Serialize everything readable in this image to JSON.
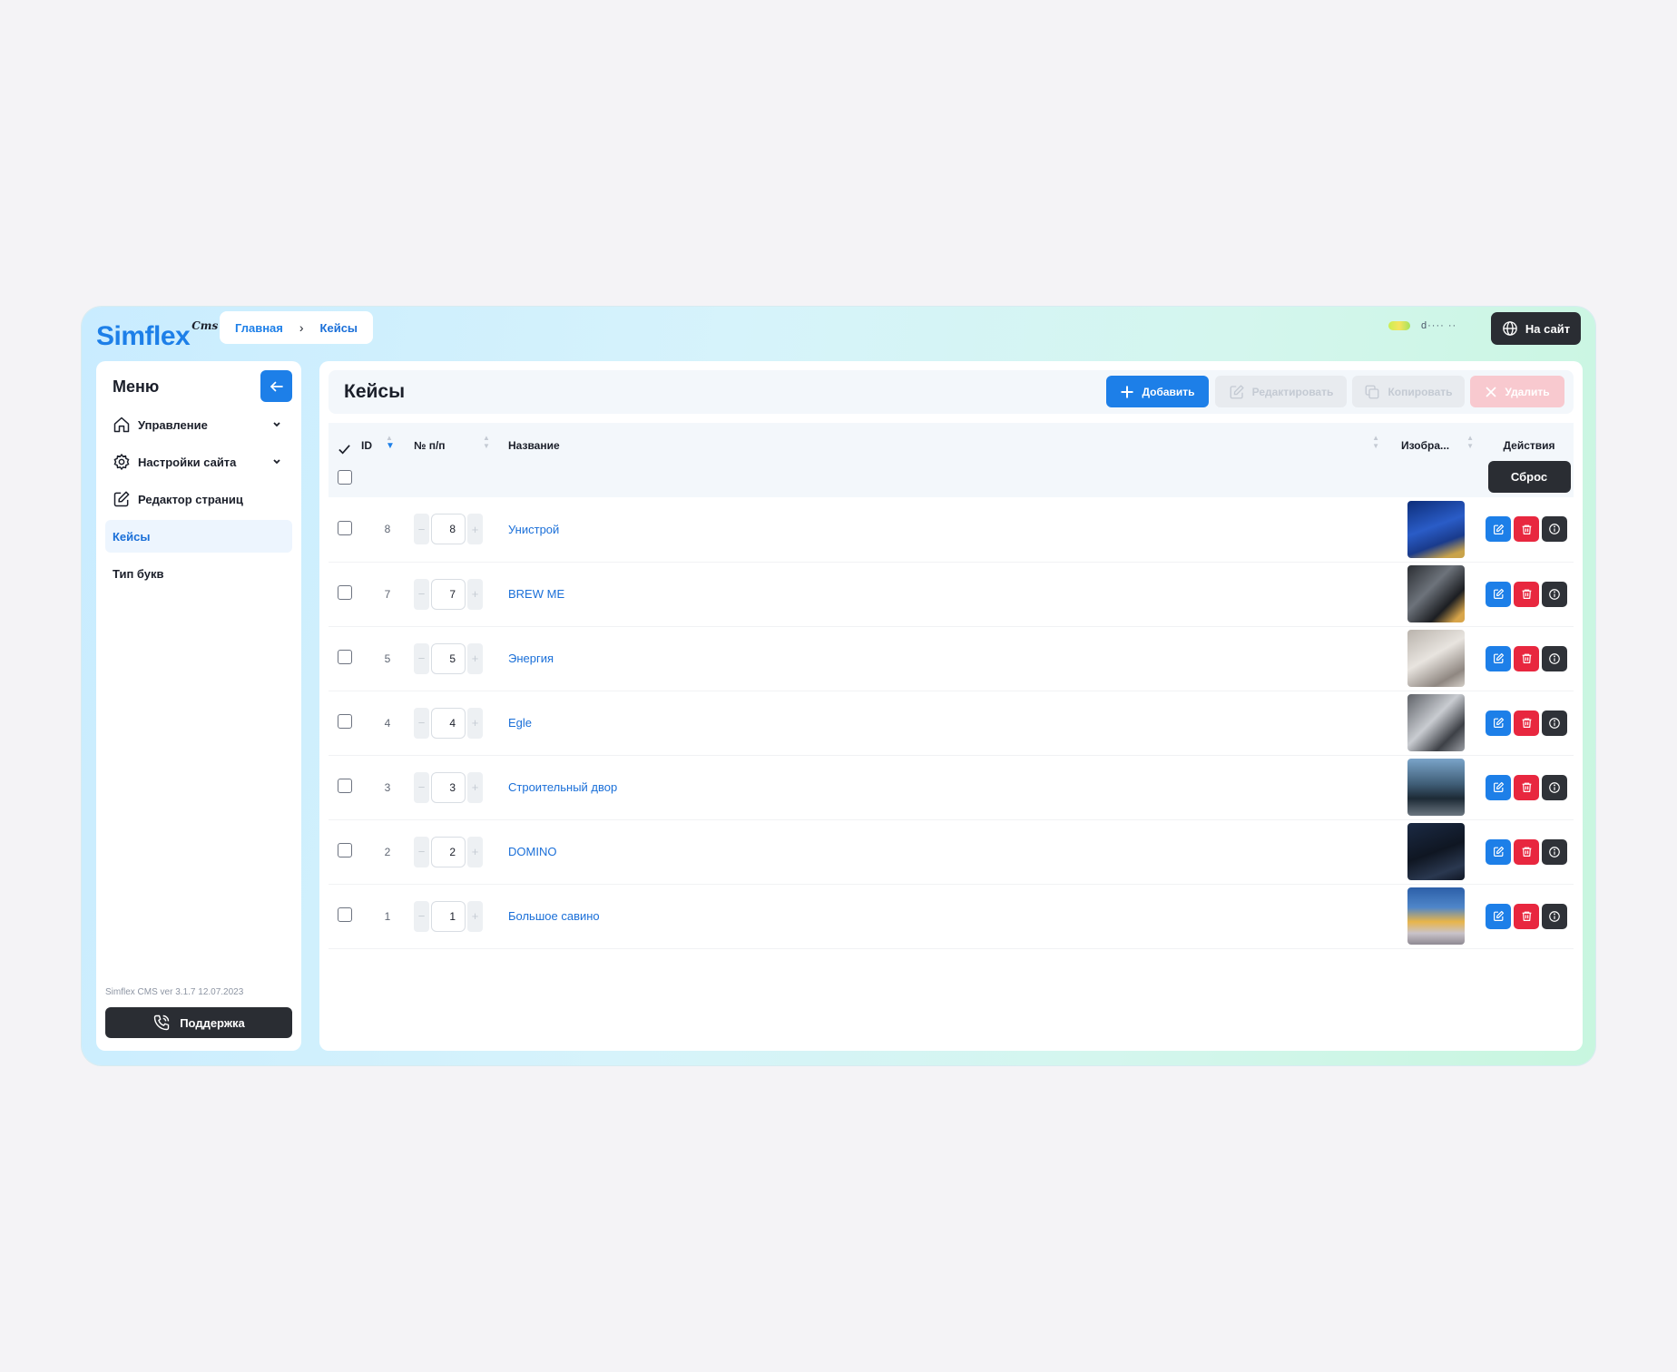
{
  "header": {
    "logo_text": "Simflex",
    "logo_suffix": "Cms",
    "breadcrumb": [
      "Главная",
      "Кейсы"
    ],
    "user_name": "d···· ··",
    "site_button": "На сайт"
  },
  "sidebar": {
    "title": "Меню",
    "items": [
      {
        "label": "Управление",
        "icon": "home-icon",
        "expandable": true
      },
      {
        "label": "Настройки сайта",
        "icon": "gear-icon",
        "expandable": true
      },
      {
        "label": "Редактор страниц",
        "icon": "edit-icon",
        "expandable": false
      },
      {
        "label": "Кейсы",
        "icon": "",
        "active": true
      },
      {
        "label": "Тип букв",
        "icon": ""
      }
    ],
    "version": "Simflex CMS ver 3.1.7 12.07.2023",
    "support_button": "Поддержка"
  },
  "main": {
    "title": "Кейсы",
    "toolbar": {
      "add": "Добавить",
      "edit": "Редактировать",
      "copy": "Копировать",
      "delete": "Удалить"
    },
    "columns": {
      "id": "ID",
      "order": "№ п/п",
      "name": "Название",
      "image": "Изобра...",
      "actions": "Действия"
    },
    "reset_button": "Сброс",
    "rows": [
      {
        "id": "8",
        "order": "8",
        "name": "Унистрой",
        "image": "unistroy-photo"
      },
      {
        "id": "7",
        "order": "7",
        "name": "BREW ME",
        "image": "brewme-photo"
      },
      {
        "id": "5",
        "order": "5",
        "name": "Энергия",
        "image": "energy-photo"
      },
      {
        "id": "4",
        "order": "4",
        "name": "Egle",
        "image": "egle-photo"
      },
      {
        "id": "3",
        "order": "3",
        "name": "Строительный двор",
        "image": "stroydvor-photo"
      },
      {
        "id": "2",
        "order": "2",
        "name": "DOMINO",
        "image": "domino-photo"
      },
      {
        "id": "1",
        "order": "1",
        "name": "Большое савино",
        "image": "savino-photo"
      }
    ]
  },
  "colors": {
    "accent": "#1d7fe8",
    "danger": "#e8273f",
    "dark": "#2a2d33"
  }
}
